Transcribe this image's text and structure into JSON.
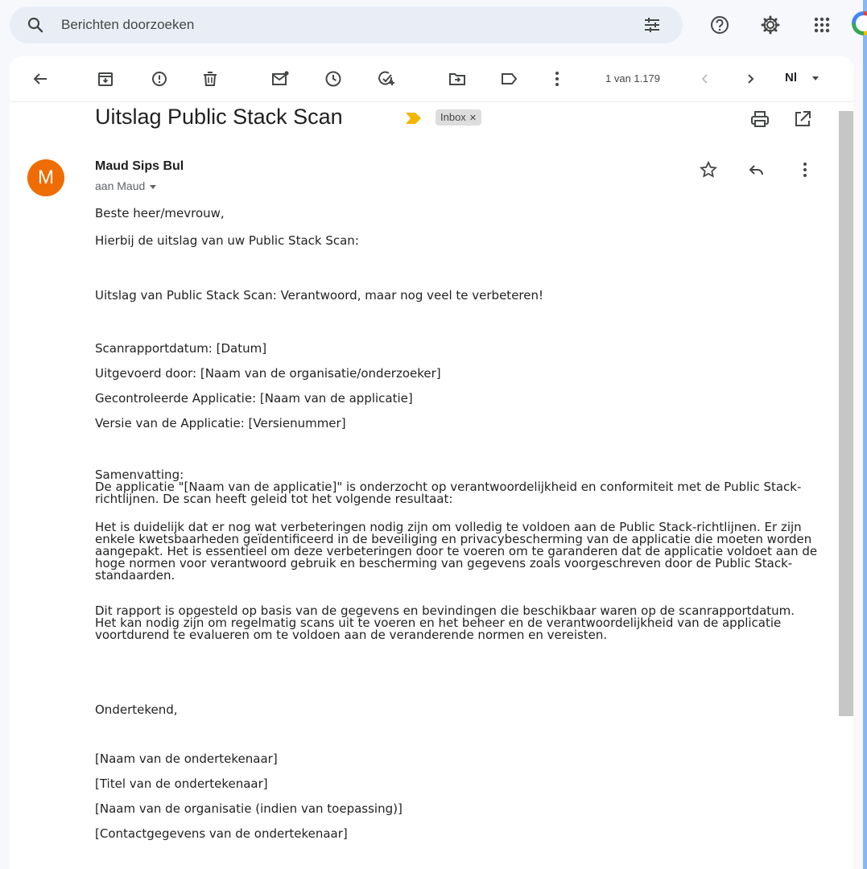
{
  "search": {
    "placeholder": "Berichten doorzoeken"
  },
  "toolbar": {
    "count": "1 van 1.179",
    "language": "Nl"
  },
  "email": {
    "subject": "Uitslag Public Stack Scan",
    "label": "Inbox",
    "sender": "Maud Sips Bul",
    "to": "aan Maud",
    "avatar_letter": "M",
    "body": {
      "greeting": "Beste heer/mevrouw,",
      "intro": "Hierbij de uitslag van uw Public Stack Scan:",
      "result": "Uitslag van Public Stack Scan: Verantwoord, maar nog veel te verbeteren!",
      "date": "Scanrapportdatum: [Datum]",
      "performed_by": "Uitgevoerd door: [Naam van de organisatie/onderzoeker]",
      "app": "Gecontroleerde Applicatie: [Naam van de applicatie]",
      "version": "Versie van de Applicatie: [Versienummer]",
      "summary_title": "Samenvatting:",
      "summary_text": "De applicatie \"[Naam van de applicatie]\" is onderzocht op verantwoordelijkheid en conformiteit met de Public Stack-richtlijnen. De scan heeft geleid tot het volgende resultaat:",
      "paragraph1": "Het is duidelijk dat er nog wat verbeteringen nodig zijn om volledig te voldoen aan de Public Stack-richtlijnen. Er zijn enkele kwetsbaarheden geïdentificeerd in de beveiliging en privacybescherming van de applicatie die moeten worden aangepakt. Het is essentieel om deze verbeteringen door te voeren om te garanderen dat de applicatie voldoet aan de hoge normen voor verantwoord gebruik en bescherming van gegevens zoals voorgeschreven door de Public Stack-standaarden.",
      "paragraph2": "Dit rapport is opgesteld op basis van de gegevens en bevindingen die beschikbaar waren op de scanrapportdatum. Het kan nodig zijn om regelmatig scans uit te voeren en het beheer en de verantwoordelijkheid van de applicatie voortdurend te evalueren om te voldoen aan de veranderende normen en vereisten.",
      "signed": "Ondertekend,",
      "sig_name": "[Naam van de ondertekenaar]",
      "sig_title": "[Titel van de ondertekenaar]",
      "sig_org": "[Naam van de organisatie (indien van toepassing)]",
      "sig_contact": "[Contactgegevens van de ondertekenaar]"
    }
  },
  "colors": {
    "accent": "#8ab4f8",
    "avatar": "#ef6c00",
    "search_bg": "#e9eef6",
    "important": "#f2b600"
  }
}
